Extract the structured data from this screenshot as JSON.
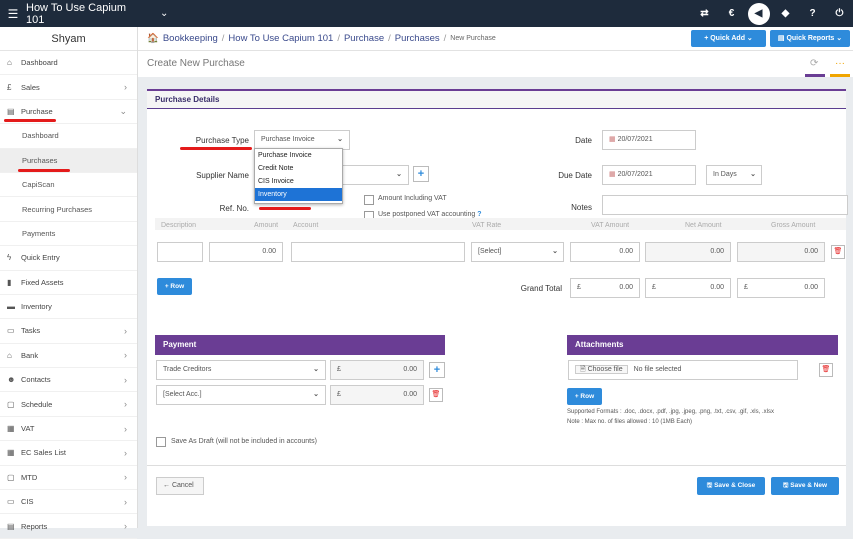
{
  "app": {
    "title": "How To Use Capium 101",
    "user": "Shyam"
  },
  "topbar": {
    "icons": [
      "transfer-icon",
      "currency-icon",
      "megaphone-icon",
      "rocket-icon",
      "help-icon",
      "power-icon"
    ],
    "glyphs": [
      "⇄",
      "€",
      "📢",
      "◆",
      "?",
      "⏻"
    ]
  },
  "sidebar": {
    "items": [
      {
        "name": "dashboard",
        "label": "Dashboard",
        "icon": "🏠"
      },
      {
        "name": "sales",
        "label": "Sales",
        "icon": "£",
        "arrow": "›"
      },
      {
        "name": "purchase",
        "label": "Purchase",
        "icon": "▤",
        "arrow": "⌄"
      }
    ],
    "purchase_sub": [
      "Dashboard",
      "Purchases",
      "CapiScan",
      "Recurring Purchases",
      "Payments"
    ],
    "items2": [
      {
        "name": "quick-entry",
        "label": "Quick Entry",
        "icon": "ϟ"
      },
      {
        "name": "fixed-assets",
        "label": "Fixed Assets",
        "icon": "▮"
      },
      {
        "name": "inventory",
        "label": "Inventory",
        "icon": "▬"
      },
      {
        "name": "tasks",
        "label": "Tasks",
        "icon": "▭",
        "arrow": "›"
      },
      {
        "name": "bank",
        "label": "Bank",
        "icon": "⌂",
        "arrow": "›"
      },
      {
        "name": "contacts",
        "label": "Contacts",
        "icon": "☻",
        "arrow": "›"
      },
      {
        "name": "schedule",
        "label": "Schedule",
        "icon": "▢",
        "arrow": "›"
      },
      {
        "name": "vat",
        "label": "VAT",
        "icon": "▦",
        "arrow": "›"
      },
      {
        "name": "ec-sales-list",
        "label": "EC Sales List",
        "icon": "▦",
        "arrow": "›"
      },
      {
        "name": "mtd",
        "label": "MTD",
        "icon": "▢",
        "arrow": "›"
      },
      {
        "name": "cis",
        "label": "CIS",
        "icon": "▭",
        "arrow": "›"
      },
      {
        "name": "reports",
        "label": "Reports",
        "icon": "▤",
        "arrow": "›"
      }
    ]
  },
  "breadcrumb": {
    "items": [
      "Bookkeeping",
      "How To Use Capium 101",
      "Purchase",
      "Purchases"
    ],
    "current": "New Purchase"
  },
  "quick": {
    "add": "+ Quick Add ⌄",
    "reports": "▤ Quick Reports ⌄"
  },
  "page": {
    "title": "Create New Purchase",
    "section": "Purchase Details"
  },
  "form": {
    "purchase_type_label": "Purchase Type",
    "purchase_type_value": "Purchase Invoice",
    "supplier_label": "Supplier Name",
    "ref_label": "Ref. No.",
    "date_label": "Date",
    "date_value": "20/07/2021",
    "due_label": "Due Date",
    "due_value": "20/07/2021",
    "due_mode": "In Days",
    "notes_label": "Notes",
    "chk_amount_vat": "Amount Including VAT",
    "chk_postponed": "Use postponed VAT accounting",
    "dropdown_options": [
      "Purchase Invoice",
      "Credit Note",
      "CIS Invoice",
      "Inventory"
    ]
  },
  "table": {
    "headers": [
      "Description",
      "Amount",
      "Account",
      "VAT Rate",
      "VAT Amount",
      "Net Amount",
      "Gross Amount"
    ],
    "row": {
      "amount": "0.00",
      "vat_rate": "[Select]",
      "vat_amount": "0.00",
      "net": "0.00",
      "gross": "0.00"
    },
    "add_row": "+ Row",
    "grand_total_label": "Grand Total",
    "currency": "£",
    "gt_vat": "0.00",
    "gt_net": "0.00",
    "gt_gross": "0.00"
  },
  "payment": {
    "title": "Payment",
    "rows": [
      {
        "account": "Trade Creditors",
        "amount": "0.00"
      },
      {
        "account": "[Select Acc.]",
        "amount": "0.00"
      }
    ]
  },
  "attachments": {
    "title": "Attachments",
    "choose": "Choose file",
    "nofile": "No file selected",
    "add_row": "+ Row",
    "formats": "Supported Formats : .doc, .docx, .pdf, .jpg, .jpeg, .png, .txt, .csv, .gif, .xls, .xlsx",
    "note": "Note : Max no. of files allowed : 10 (1MB Each)"
  },
  "draft_label": "Save As Draft (will not be included in accounts)",
  "buttons": {
    "cancel": "← Cancel",
    "save_close": "Save & Close",
    "save_new": "Save & New"
  }
}
